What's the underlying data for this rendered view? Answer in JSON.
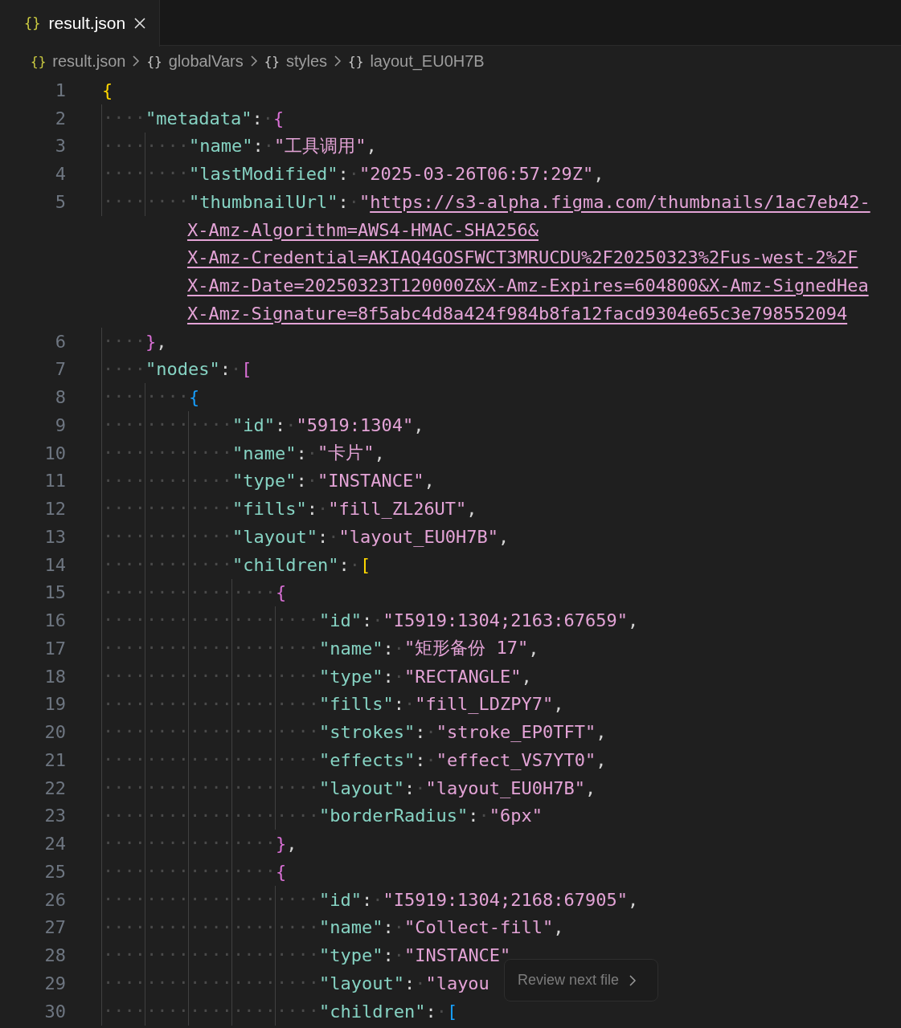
{
  "tab": {
    "icon": "{}",
    "label": "result.json",
    "selected": true
  },
  "breadcrumbs": [
    {
      "icon": "{}",
      "label": "result.json",
      "kind": "file"
    },
    {
      "icon": "{}",
      "label": "globalVars",
      "kind": "object"
    },
    {
      "icon": "{}",
      "label": "styles",
      "kind": "object"
    },
    {
      "icon": "{}",
      "label": "layout_EU0H7B",
      "kind": "object"
    }
  ],
  "lines": [
    {
      "number": "1",
      "tokens": [
        {
          "kind": "bracket",
          "text": "{",
          "color": "#ffd700"
        }
      ]
    },
    {
      "number": "2",
      "tokens": [
        {
          "kind": "ws",
          "text": "····"
        },
        {
          "kind": "key",
          "text": "\"metadata\""
        },
        {
          "kind": "punct",
          "text": ":"
        },
        {
          "kind": "ws",
          "text": "·"
        },
        {
          "kind": "bracket",
          "text": "{",
          "color": "#da70d6"
        }
      ]
    },
    {
      "number": "3",
      "tokens": [
        {
          "kind": "ws",
          "text": "········"
        },
        {
          "kind": "key",
          "text": "\"name\""
        },
        {
          "kind": "punct",
          "text": ":"
        },
        {
          "kind": "ws",
          "text": "·"
        },
        {
          "kind": "string",
          "text": "\"工具调用\""
        },
        {
          "kind": "punct",
          "text": ","
        }
      ]
    },
    {
      "number": "4",
      "tokens": [
        {
          "kind": "ws",
          "text": "········"
        },
        {
          "kind": "key",
          "text": "\"lastModified\""
        },
        {
          "kind": "punct",
          "text": ":"
        },
        {
          "kind": "ws",
          "text": "·"
        },
        {
          "kind": "string",
          "text": "\"2025-03-26T06:57:29Z\""
        },
        {
          "kind": "punct",
          "text": ","
        }
      ]
    },
    {
      "number": "5",
      "tokens": [
        {
          "kind": "ws",
          "text": "········"
        },
        {
          "kind": "key",
          "text": "\"thumbnailUrl\""
        },
        {
          "kind": "punct",
          "text": ":"
        },
        {
          "kind": "ws",
          "text": "·"
        },
        {
          "kind": "string",
          "text": "\""
        },
        {
          "kind": "link",
          "text": "https://s3-alpha.figma.com/thumbnails/1ac7eb42-"
        }
      ]
    },
    {
      "tokens": [
        {
          "kind": "link",
          "text": "X-Amz-Algorithm=AWS4-HMAC-SHA256&"
        }
      ]
    },
    {
      "tokens": [
        {
          "kind": "link",
          "text": "X-Amz-Credential=AKIAQ4GOSFWCT3MRUCDU%2F20250323%2Fus-west-2%2F"
        }
      ]
    },
    {
      "tokens": [
        {
          "kind": "link",
          "text": "X-Amz-Date=20250323T120000Z&X-Amz-Expires=604800&X-Amz-SignedHea"
        }
      ]
    },
    {
      "tokens": [
        {
          "kind": "link",
          "text": "X-Amz-Signature=8f5abc4d8a424f984b8fa12facd9304e65c3e798552094"
        }
      ]
    },
    {
      "number": "6",
      "tokens": [
        {
          "kind": "ws",
          "text": "····"
        },
        {
          "kind": "bracket",
          "text": "}",
          "color": "#da70d6"
        },
        {
          "kind": "punct",
          "text": ","
        }
      ]
    },
    {
      "number": "7",
      "tokens": [
        {
          "kind": "ws",
          "text": "····"
        },
        {
          "kind": "key",
          "text": "\"nodes\""
        },
        {
          "kind": "punct",
          "text": ":"
        },
        {
          "kind": "ws",
          "text": "·"
        },
        {
          "kind": "bracket",
          "text": "[",
          "color": "#da70d6"
        }
      ]
    },
    {
      "number": "8",
      "tokens": [
        {
          "kind": "ws",
          "text": "········"
        },
        {
          "kind": "bracket",
          "text": "{",
          "color": "#179fff"
        }
      ]
    },
    {
      "number": "9",
      "tokens": [
        {
          "kind": "ws",
          "text": "············"
        },
        {
          "kind": "key",
          "text": "\"id\""
        },
        {
          "kind": "punct",
          "text": ":"
        },
        {
          "kind": "ws",
          "text": "·"
        },
        {
          "kind": "string",
          "text": "\"5919:1304\""
        },
        {
          "kind": "punct",
          "text": ","
        }
      ]
    },
    {
      "number": "10",
      "tokens": [
        {
          "kind": "ws",
          "text": "············"
        },
        {
          "kind": "key",
          "text": "\"name\""
        },
        {
          "kind": "punct",
          "text": ":"
        },
        {
          "kind": "ws",
          "text": "·"
        },
        {
          "kind": "string",
          "text": "\"卡片\""
        },
        {
          "kind": "punct",
          "text": ","
        }
      ]
    },
    {
      "number": "11",
      "tokens": [
        {
          "kind": "ws",
          "text": "············"
        },
        {
          "kind": "key",
          "text": "\"type\""
        },
        {
          "kind": "punct",
          "text": ":"
        },
        {
          "kind": "ws",
          "text": "·"
        },
        {
          "kind": "string",
          "text": "\"INSTANCE\""
        },
        {
          "kind": "punct",
          "text": ","
        }
      ]
    },
    {
      "number": "12",
      "tokens": [
        {
          "kind": "ws",
          "text": "············"
        },
        {
          "kind": "key",
          "text": "\"fills\""
        },
        {
          "kind": "punct",
          "text": ":"
        },
        {
          "kind": "ws",
          "text": "·"
        },
        {
          "kind": "string",
          "text": "\"fill_ZL26UT\""
        },
        {
          "kind": "punct",
          "text": ","
        }
      ]
    },
    {
      "number": "13",
      "tokens": [
        {
          "kind": "ws",
          "text": "············"
        },
        {
          "kind": "key",
          "text": "\"layout\""
        },
        {
          "kind": "punct",
          "text": ":"
        },
        {
          "kind": "ws",
          "text": "·"
        },
        {
          "kind": "string",
          "text": "\"layout_EU0H7B\""
        },
        {
          "kind": "punct",
          "text": ","
        }
      ]
    },
    {
      "number": "14",
      "tokens": [
        {
          "kind": "ws",
          "text": "············"
        },
        {
          "kind": "key",
          "text": "\"children\""
        },
        {
          "kind": "punct",
          "text": ":"
        },
        {
          "kind": "ws",
          "text": "·"
        },
        {
          "kind": "bracket",
          "text": "[",
          "color": "#ffd700"
        }
      ]
    },
    {
      "number": "15",
      "tokens": [
        {
          "kind": "ws",
          "text": "················"
        },
        {
          "kind": "bracket",
          "text": "{",
          "color": "#da70d6"
        }
      ]
    },
    {
      "number": "16",
      "tokens": [
        {
          "kind": "ws",
          "text": "····················"
        },
        {
          "kind": "key",
          "text": "\"id\""
        },
        {
          "kind": "punct",
          "text": ":"
        },
        {
          "kind": "ws",
          "text": "·"
        },
        {
          "kind": "string",
          "text": "\"I5919:1304;2163:67659\""
        },
        {
          "kind": "punct",
          "text": ","
        }
      ]
    },
    {
      "number": "17",
      "tokens": [
        {
          "kind": "ws",
          "text": "····················"
        },
        {
          "kind": "key",
          "text": "\"name\""
        },
        {
          "kind": "punct",
          "text": ":"
        },
        {
          "kind": "ws",
          "text": "·"
        },
        {
          "kind": "string",
          "text": "\"矩形备份 17\""
        },
        {
          "kind": "punct",
          "text": ","
        }
      ]
    },
    {
      "number": "18",
      "tokens": [
        {
          "kind": "ws",
          "text": "····················"
        },
        {
          "kind": "key",
          "text": "\"type\""
        },
        {
          "kind": "punct",
          "text": ":"
        },
        {
          "kind": "ws",
          "text": "·"
        },
        {
          "kind": "string",
          "text": "\"RECTANGLE\""
        },
        {
          "kind": "punct",
          "text": ","
        }
      ]
    },
    {
      "number": "19",
      "tokens": [
        {
          "kind": "ws",
          "text": "····················"
        },
        {
          "kind": "key",
          "text": "\"fills\""
        },
        {
          "kind": "punct",
          "text": ":"
        },
        {
          "kind": "ws",
          "text": "·"
        },
        {
          "kind": "string",
          "text": "\"fill_LDZPY7\""
        },
        {
          "kind": "punct",
          "text": ","
        }
      ]
    },
    {
      "number": "20",
      "tokens": [
        {
          "kind": "ws",
          "text": "····················"
        },
        {
          "kind": "key",
          "text": "\"strokes\""
        },
        {
          "kind": "punct",
          "text": ":"
        },
        {
          "kind": "ws",
          "text": "·"
        },
        {
          "kind": "string",
          "text": "\"stroke_EP0TFT\""
        },
        {
          "kind": "punct",
          "text": ","
        }
      ]
    },
    {
      "number": "21",
      "tokens": [
        {
          "kind": "ws",
          "text": "····················"
        },
        {
          "kind": "key",
          "text": "\"effects\""
        },
        {
          "kind": "punct",
          "text": ":"
        },
        {
          "kind": "ws",
          "text": "·"
        },
        {
          "kind": "string",
          "text": "\"effect_VS7YT0\""
        },
        {
          "kind": "punct",
          "text": ","
        }
      ]
    },
    {
      "number": "22",
      "tokens": [
        {
          "kind": "ws",
          "text": "····················"
        },
        {
          "kind": "key",
          "text": "\"layout\""
        },
        {
          "kind": "punct",
          "text": ":"
        },
        {
          "kind": "ws",
          "text": "·"
        },
        {
          "kind": "string",
          "text": "\"layout_EU0H7B\""
        },
        {
          "kind": "punct",
          "text": ","
        }
      ]
    },
    {
      "number": "23",
      "tokens": [
        {
          "kind": "ws",
          "text": "····················"
        },
        {
          "kind": "key",
          "text": "\"borderRadius\""
        },
        {
          "kind": "punct",
          "text": ":"
        },
        {
          "kind": "ws",
          "text": "·"
        },
        {
          "kind": "string",
          "text": "\"6px\""
        }
      ]
    },
    {
      "number": "24",
      "tokens": [
        {
          "kind": "ws",
          "text": "················"
        },
        {
          "kind": "bracket",
          "text": "}",
          "color": "#da70d6"
        },
        {
          "kind": "punct",
          "text": ","
        }
      ]
    },
    {
      "number": "25",
      "tokens": [
        {
          "kind": "ws",
          "text": "················"
        },
        {
          "kind": "bracket",
          "text": "{",
          "color": "#da70d6"
        }
      ]
    },
    {
      "number": "26",
      "tokens": [
        {
          "kind": "ws",
          "text": "····················"
        },
        {
          "kind": "key",
          "text": "\"id\""
        },
        {
          "kind": "punct",
          "text": ":"
        },
        {
          "kind": "ws",
          "text": "·"
        },
        {
          "kind": "string",
          "text": "\"I5919:1304;2168:67905\""
        },
        {
          "kind": "punct",
          "text": ","
        }
      ]
    },
    {
      "number": "27",
      "tokens": [
        {
          "kind": "ws",
          "text": "····················"
        },
        {
          "kind": "key",
          "text": "\"name\""
        },
        {
          "kind": "punct",
          "text": ":"
        },
        {
          "kind": "ws",
          "text": "·"
        },
        {
          "kind": "string",
          "text": "\"Collect-fill\""
        },
        {
          "kind": "punct",
          "text": ","
        }
      ]
    },
    {
      "number": "28",
      "tokens": [
        {
          "kind": "ws",
          "text": "····················"
        },
        {
          "kind": "key",
          "text": "\"type\""
        },
        {
          "kind": "punct",
          "text": ":"
        },
        {
          "kind": "ws",
          "text": "·"
        },
        {
          "kind": "string",
          "text": "\"INSTANCE\""
        }
      ]
    },
    {
      "number": "29",
      "tokens": [
        {
          "kind": "ws",
          "text": "····················"
        },
        {
          "kind": "key",
          "text": "\"layout\""
        },
        {
          "kind": "punct",
          "text": ":"
        },
        {
          "kind": "ws",
          "text": "·"
        },
        {
          "kind": "string",
          "text": "\"layou"
        }
      ]
    },
    {
      "number": "30",
      "tokens": [
        {
          "kind": "ws",
          "text": "····················"
        },
        {
          "kind": "key",
          "text": "\"children\""
        },
        {
          "kind": "punct",
          "text": ":"
        },
        {
          "kind": "ws",
          "text": "·"
        },
        {
          "kind": "bracket",
          "text": "[",
          "color": "#179fff"
        }
      ]
    }
  ],
  "review_button": {
    "label": "Review next file"
  }
}
